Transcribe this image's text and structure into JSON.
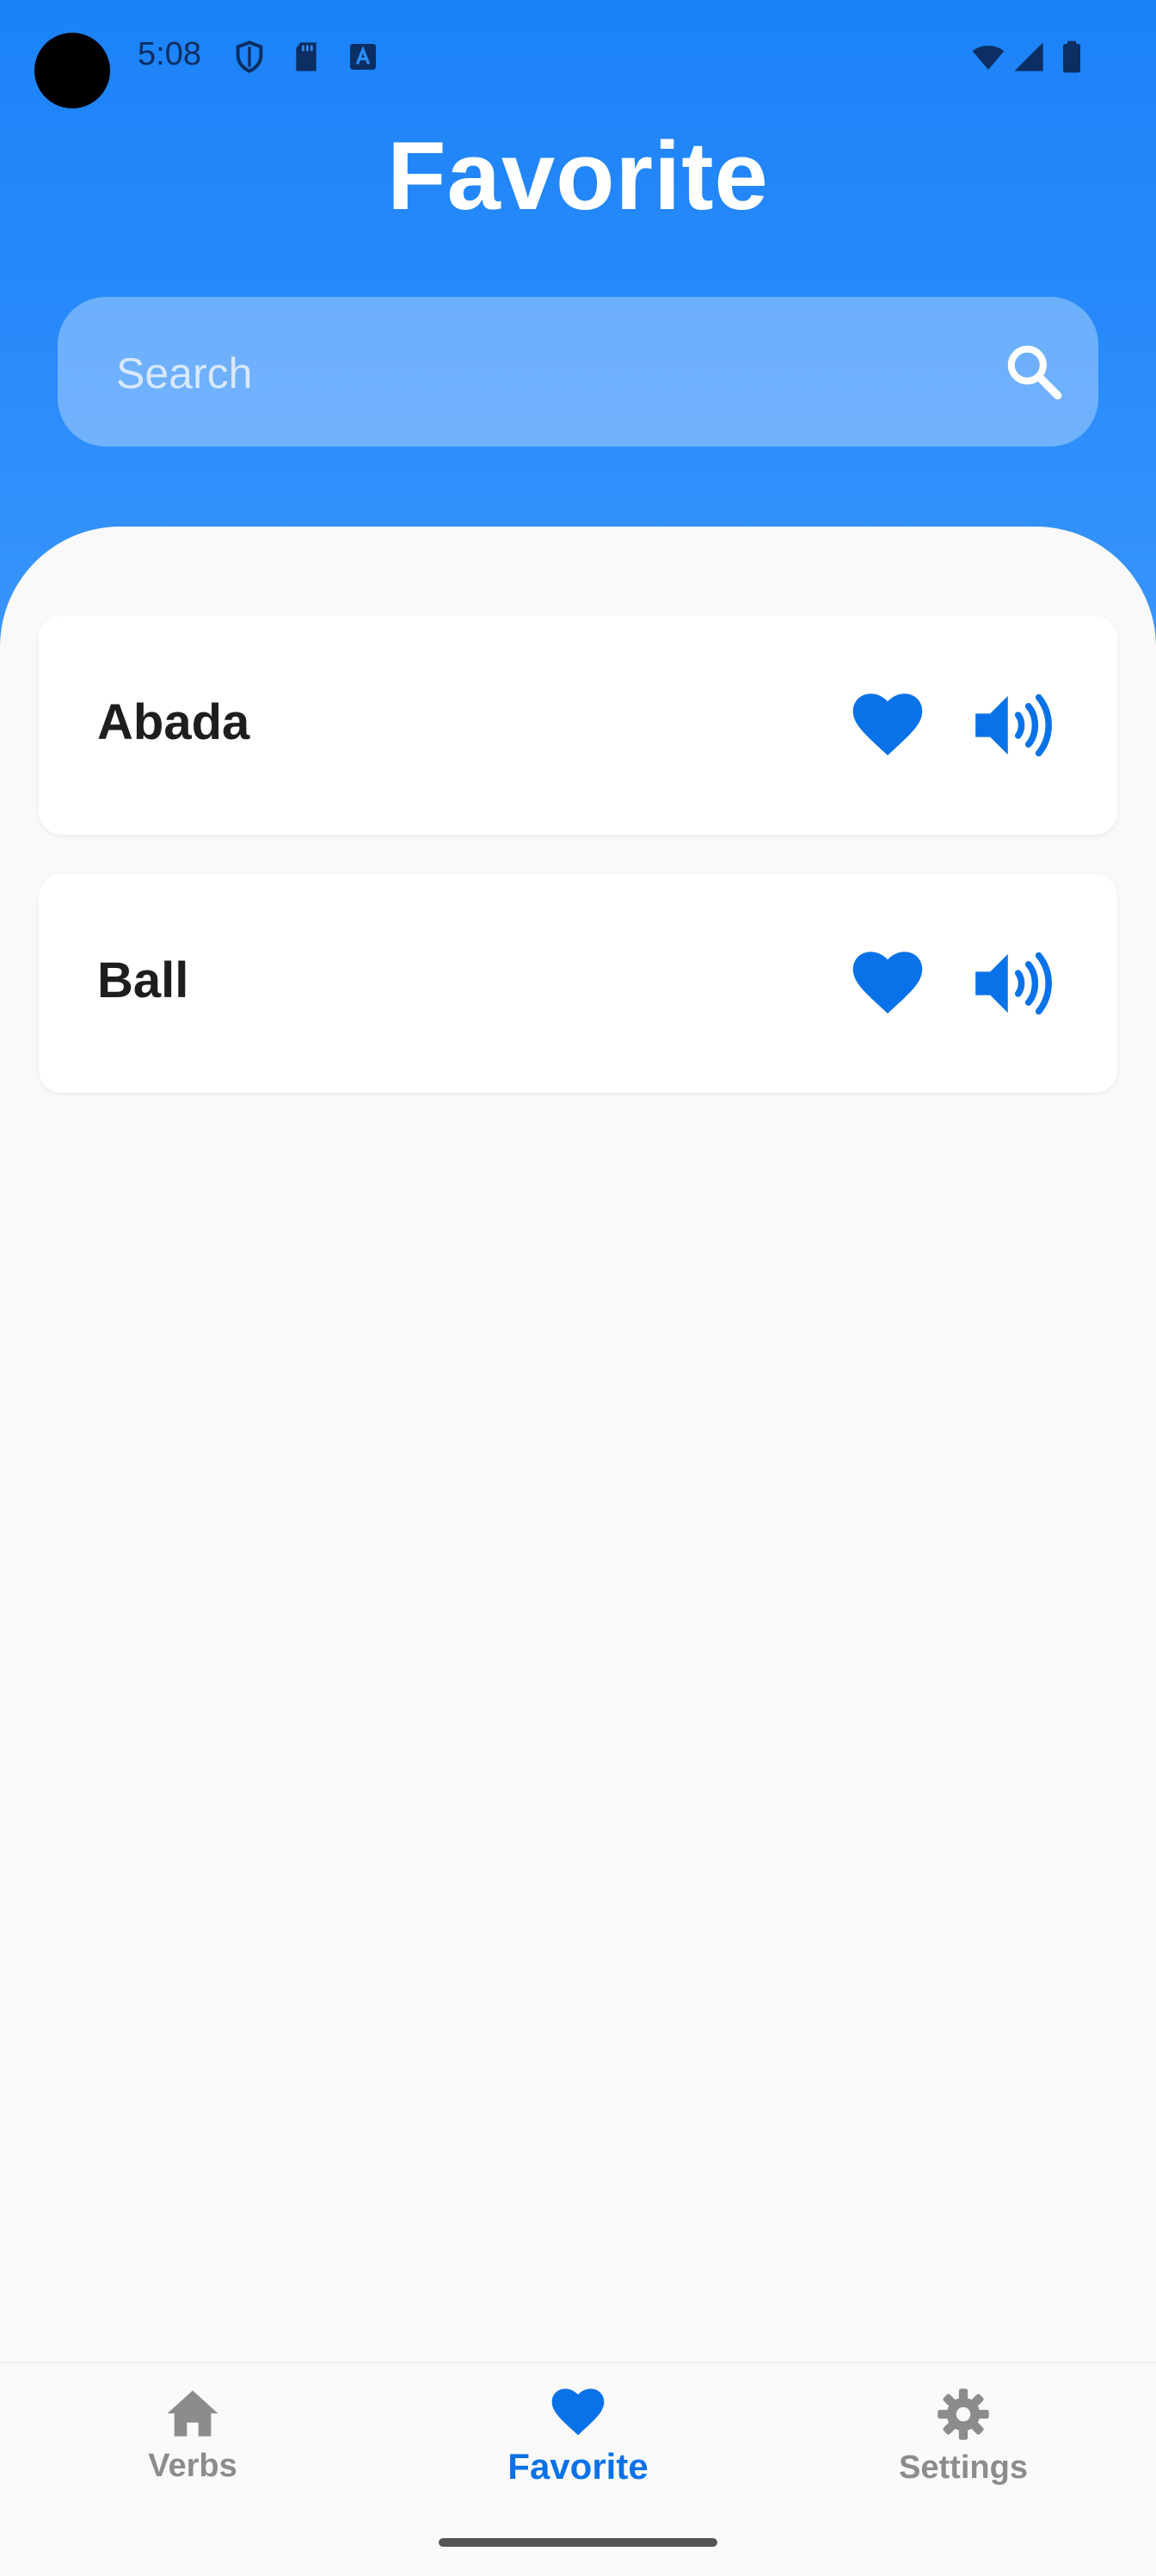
{
  "status_bar": {
    "time": "5:08",
    "left_icons": [
      "shield-icon",
      "sd-card-icon",
      "a-box-icon"
    ],
    "right_icons": [
      "wifi-icon",
      "signal-icon",
      "battery-icon"
    ]
  },
  "header": {
    "title": "Favorite"
  },
  "search": {
    "placeholder": "Search",
    "icon": "search-icon"
  },
  "favorites": [
    {
      "word": "Abada",
      "favorited": true,
      "icons": [
        "heart-icon",
        "speaker-icon"
      ]
    },
    {
      "word": "Ball",
      "favorited": true,
      "icons": [
        "heart-icon",
        "speaker-icon"
      ]
    }
  ],
  "bottom_nav": {
    "items": [
      {
        "label": "Verbs",
        "icon": "home-icon",
        "active": false
      },
      {
        "label": "Favorite",
        "icon": "heart-icon",
        "active": true
      },
      {
        "label": "Settings",
        "icon": "gear-icon",
        "active": false
      }
    ]
  },
  "colors": {
    "accent": "#0a72e8",
    "header_top": "#1b82f7",
    "inactive": "#8c8c8c",
    "background": "#f9f9f9"
  }
}
